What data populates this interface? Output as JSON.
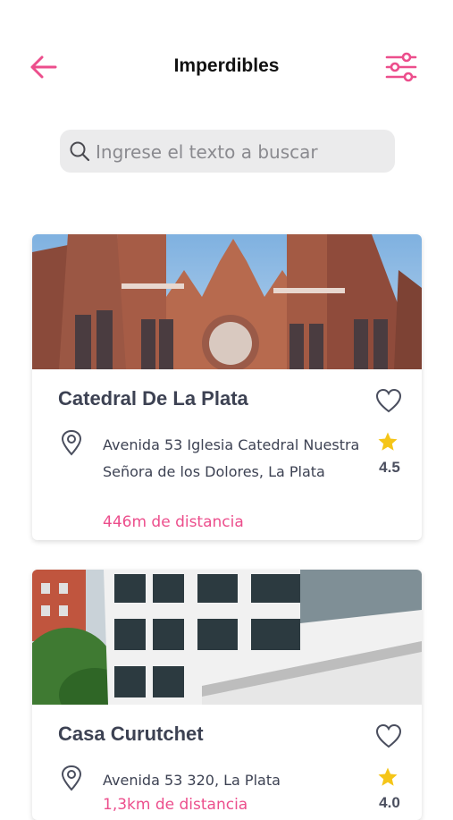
{
  "header": {
    "title": "Imperdibles",
    "back_icon": "arrow-left-icon",
    "filter_icon": "sliders-icon",
    "accent_color": "#ec4e8c"
  },
  "search": {
    "placeholder": "Ingrese el texto a buscar",
    "value": ""
  },
  "places": [
    {
      "name": "Catedral De La Plata",
      "address": "Avenida 53 Iglesia Catedral Nuestra Señora de los Dolores, La Plata",
      "distance": "446m de distancia",
      "rating": "4.5",
      "favorited": false
    },
    {
      "name": "Casa Curutchet",
      "address": "Avenida 53 320, La Plata",
      "distance": "1,3km de distancia",
      "rating": "4.0",
      "favorited": false
    }
  ],
  "colors": {
    "accent": "#ec4e8c",
    "star": "#f5c518",
    "text": "#3d4253"
  }
}
